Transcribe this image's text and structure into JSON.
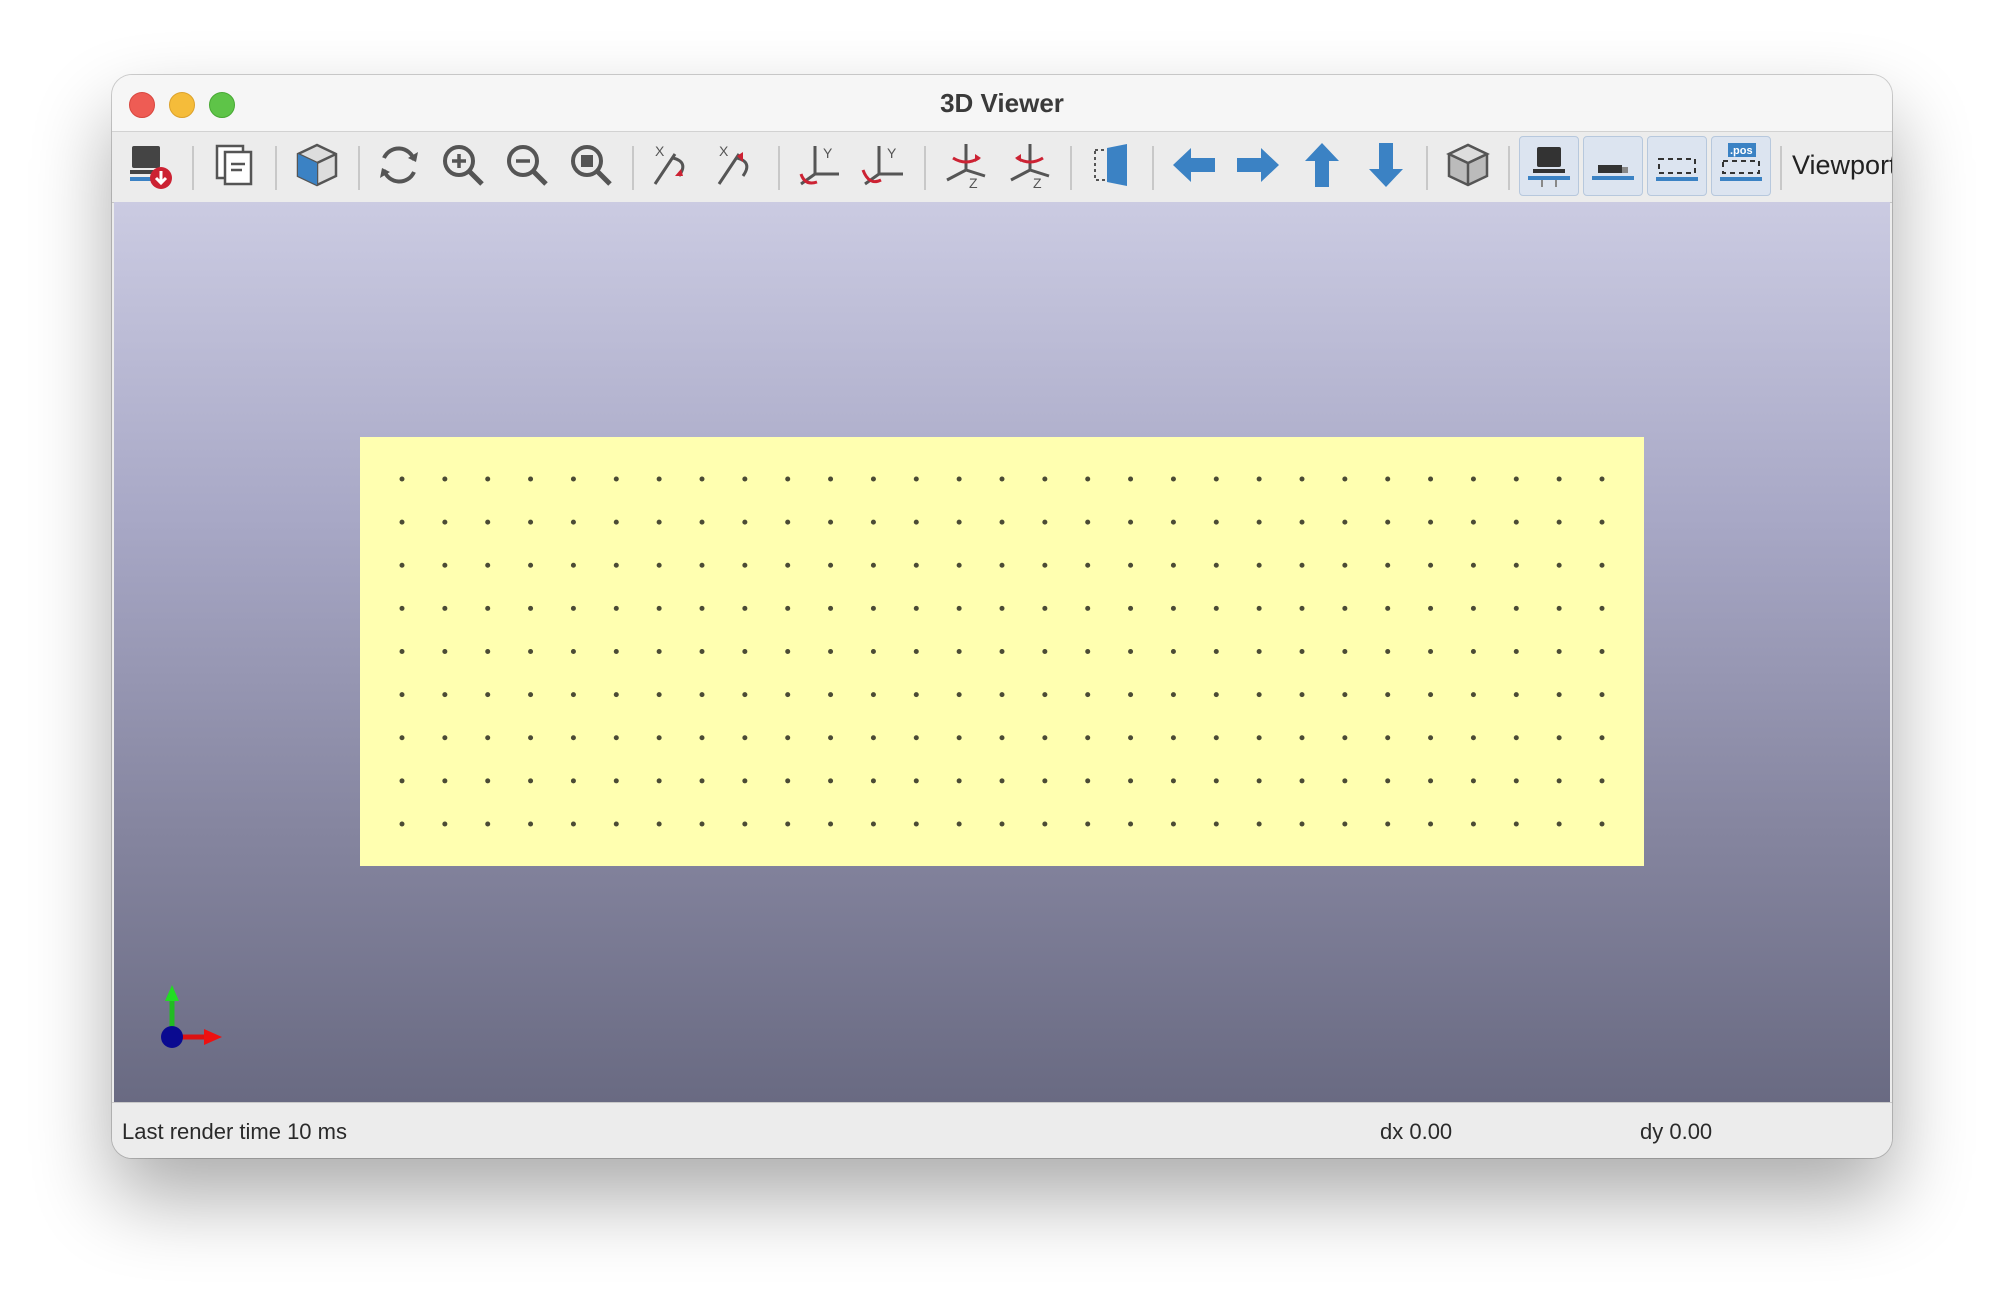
{
  "window": {
    "title": "3D Viewer"
  },
  "toolbar": {
    "buttons": [
      {
        "icon": "export-image-icon",
        "label": "Export image"
      },
      {
        "icon": "copy-icon",
        "label": "Copy to clipboard"
      },
      {
        "icon": "raytrace-cube-icon",
        "label": "Render with raytracing"
      },
      {
        "icon": "reload-icon",
        "label": "Reload board"
      },
      {
        "icon": "zoom-in-icon",
        "label": "Zoom in"
      },
      {
        "icon": "zoom-out-icon",
        "label": "Zoom out"
      },
      {
        "icon": "zoom-fit-icon",
        "label": "Zoom to fit"
      },
      {
        "icon": "rotate-x-cw-icon",
        "label": "Rotate X clockwise"
      },
      {
        "icon": "rotate-x-ccw-icon",
        "label": "Rotate X counterclockwise"
      },
      {
        "icon": "rotate-y-cw-icon",
        "label": "Rotate Y clockwise"
      },
      {
        "icon": "rotate-y-ccw-icon",
        "label": "Rotate Y counterclockwise"
      },
      {
        "icon": "rotate-z-cw-icon",
        "label": "Rotate Z clockwise"
      },
      {
        "icon": "rotate-z-ccw-icon",
        "label": "Rotate Z counterclockwise"
      },
      {
        "icon": "flip-board-icon",
        "label": "Flip board"
      },
      {
        "icon": "arrow-left-icon",
        "label": "Pan left"
      },
      {
        "icon": "arrow-right-icon",
        "label": "Pan right"
      },
      {
        "icon": "arrow-up-icon",
        "label": "Pan up"
      },
      {
        "icon": "arrow-down-icon",
        "label": "Pan down"
      },
      {
        "icon": "ortho-cube-icon",
        "label": "Orthographic projection"
      },
      {
        "icon": "show-tht-icon",
        "label": "Show THT models",
        "checked": true
      },
      {
        "icon": "show-smd-icon",
        "label": "Show SMD models",
        "checked": true
      },
      {
        "icon": "show-virtual-icon",
        "label": "Show virtual models",
        "checked": true
      },
      {
        "icon": "show-not-in-pos-icon",
        "label": "Show models not in POS file",
        "checked": true
      }
    ],
    "viewport_label": "Viewports",
    "pos_icon_text": ".pos",
    "axis_letters": {
      "x": "X",
      "y": "Y",
      "z": "Z"
    }
  },
  "colors": {
    "board": "#ffffb0",
    "pad": "#4b4b35",
    "icon_blue": "#3b82c4",
    "icon_gray": "#555555",
    "icon_red": "#cc2233"
  },
  "board": {
    "pad_grid": {
      "rows": 9,
      "columns": 29
    }
  },
  "status": {
    "render_time": "Last render time 10 ms",
    "dx": "dx 0.00",
    "dy": "dy 0.00"
  }
}
